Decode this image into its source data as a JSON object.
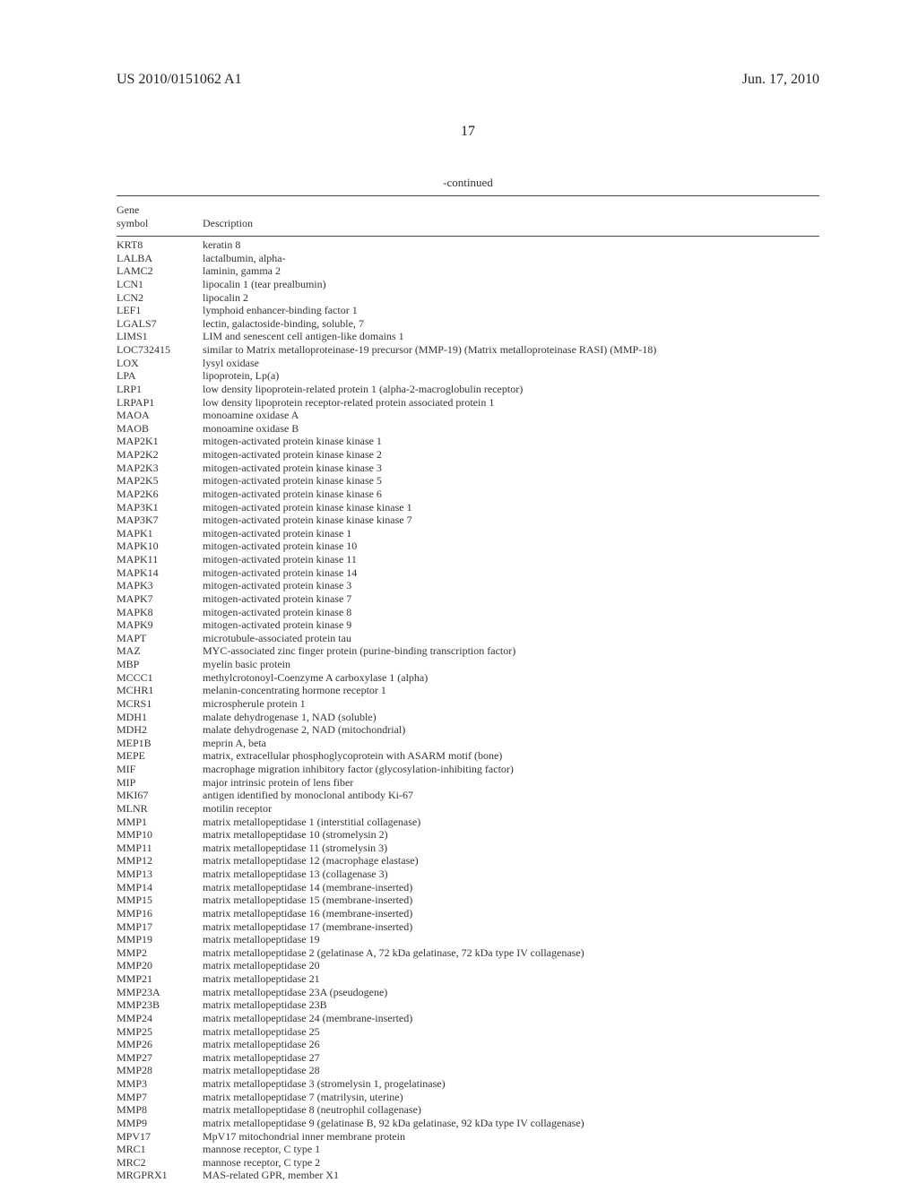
{
  "header": {
    "left": "US 2010/0151062 A1",
    "right": "Jun. 17, 2010",
    "page_number": "17"
  },
  "table": {
    "continued": "-continued",
    "col1": "Gene\nsymbol",
    "col2": "Description",
    "rows": [
      {
        "sym": "KRT8",
        "desc": "keratin 8"
      },
      {
        "sym": "LALBA",
        "desc": "lactalbumin, alpha-"
      },
      {
        "sym": "LAMC2",
        "desc": "laminin, gamma 2"
      },
      {
        "sym": "LCN1",
        "desc": "lipocalin 1 (tear prealbumin)"
      },
      {
        "sym": "LCN2",
        "desc": "lipocalin 2"
      },
      {
        "sym": "LEF1",
        "desc": "lymphoid enhancer-binding factor 1"
      },
      {
        "sym": "LGALS7",
        "desc": "lectin, galactoside-binding, soluble, 7"
      },
      {
        "sym": "LIMS1",
        "desc": "LIM and senescent cell antigen-like domains 1"
      },
      {
        "sym": "LOC732415",
        "desc": "similar to Matrix metalloproteinase-19 precursor (MMP-19) (Matrix metalloproteinase RASI) (MMP-18)"
      },
      {
        "sym": "LOX",
        "desc": "lysyl oxidase"
      },
      {
        "sym": "LPA",
        "desc": "lipoprotein, Lp(a)"
      },
      {
        "sym": "LRP1",
        "desc": "low density lipoprotein-related protein 1 (alpha-2-macroglobulin receptor)"
      },
      {
        "sym": "LRPAP1",
        "desc": "low density lipoprotein receptor-related protein associated protein 1"
      },
      {
        "sym": "MAOA",
        "desc": "monoamine oxidase A"
      },
      {
        "sym": "MAOB",
        "desc": "monoamine oxidase B"
      },
      {
        "sym": "MAP2K1",
        "desc": "mitogen-activated protein kinase kinase 1"
      },
      {
        "sym": "MAP2K2",
        "desc": "mitogen-activated protein kinase kinase 2"
      },
      {
        "sym": "MAP2K3",
        "desc": "mitogen-activated protein kinase kinase 3"
      },
      {
        "sym": "MAP2K5",
        "desc": "mitogen-activated protein kinase kinase 5"
      },
      {
        "sym": "MAP2K6",
        "desc": "mitogen-activated protein kinase kinase 6"
      },
      {
        "sym": "MAP3K1",
        "desc": "mitogen-activated protein kinase kinase kinase 1"
      },
      {
        "sym": "MAP3K7",
        "desc": "mitogen-activated protein kinase kinase kinase 7"
      },
      {
        "sym": "MAPK1",
        "desc": "mitogen-activated protein kinase 1"
      },
      {
        "sym": "MAPK10",
        "desc": "mitogen-activated protein kinase 10"
      },
      {
        "sym": "MAPK11",
        "desc": "mitogen-activated protein kinase 11"
      },
      {
        "sym": "MAPK14",
        "desc": "mitogen-activated protein kinase 14"
      },
      {
        "sym": "MAPK3",
        "desc": "mitogen-activated protein kinase 3"
      },
      {
        "sym": "MAPK7",
        "desc": "mitogen-activated protein kinase 7"
      },
      {
        "sym": "MAPK8",
        "desc": "mitogen-activated protein kinase 8"
      },
      {
        "sym": "MAPK9",
        "desc": "mitogen-activated protein kinase 9"
      },
      {
        "sym": "MAPT",
        "desc": "microtubule-associated protein tau"
      },
      {
        "sym": "MAZ",
        "desc": "MYC-associated zinc finger protein (purine-binding transcription factor)"
      },
      {
        "sym": "MBP",
        "desc": "myelin basic protein"
      },
      {
        "sym": "MCCC1",
        "desc": "methylcrotonoyl-Coenzyme A carboxylase 1 (alpha)"
      },
      {
        "sym": "MCHR1",
        "desc": "melanin-concentrating hormone receptor 1"
      },
      {
        "sym": "MCRS1",
        "desc": "microspherule protein 1"
      },
      {
        "sym": "MDH1",
        "desc": "malate dehydrogenase 1, NAD (soluble)"
      },
      {
        "sym": "MDH2",
        "desc": "malate dehydrogenase 2, NAD (mitochondrial)"
      },
      {
        "sym": "MEP1B",
        "desc": "meprin A, beta"
      },
      {
        "sym": "MEPE",
        "desc": "matrix, extracellular phosphoglycoprotein with ASARM motif (bone)"
      },
      {
        "sym": "MIF",
        "desc": "macrophage migration inhibitory factor (glycosylation-inhibiting factor)"
      },
      {
        "sym": "MIP",
        "desc": "major intrinsic protein of lens fiber"
      },
      {
        "sym": "MKI67",
        "desc": "antigen identified by monoclonal antibody Ki-67"
      },
      {
        "sym": "MLNR",
        "desc": "motilin receptor"
      },
      {
        "sym": "MMP1",
        "desc": "matrix metallopeptidase 1 (interstitial collagenase)"
      },
      {
        "sym": "MMP10",
        "desc": "matrix metallopeptidase 10 (stromelysin 2)"
      },
      {
        "sym": "MMP11",
        "desc": "matrix metallopeptidase 11 (stromelysin 3)"
      },
      {
        "sym": "MMP12",
        "desc": "matrix metallopeptidase 12 (macrophage elastase)"
      },
      {
        "sym": "MMP13",
        "desc": "matrix metallopeptidase 13 (collagenase 3)"
      },
      {
        "sym": "MMP14",
        "desc": "matrix metallopeptidase 14 (membrane-inserted)"
      },
      {
        "sym": "MMP15",
        "desc": "matrix metallopeptidase 15 (membrane-inserted)"
      },
      {
        "sym": "MMP16",
        "desc": "matrix metallopeptidase 16 (membrane-inserted)"
      },
      {
        "sym": "MMP17",
        "desc": "matrix metallopeptidase 17 (membrane-inserted)"
      },
      {
        "sym": "MMP19",
        "desc": "matrix metallopeptidase 19"
      },
      {
        "sym": "MMP2",
        "desc": "matrix metallopeptidase 2 (gelatinase A, 72 kDa gelatinase, 72 kDa type IV collagenase)"
      },
      {
        "sym": "MMP20",
        "desc": "matrix metallopeptidase 20"
      },
      {
        "sym": "MMP21",
        "desc": "matrix metallopeptidase 21"
      },
      {
        "sym": "MMP23A",
        "desc": "matrix metallopeptidase 23A (pseudogene)"
      },
      {
        "sym": "MMP23B",
        "desc": "matrix metallopeptidase 23B"
      },
      {
        "sym": "MMP24",
        "desc": "matrix metallopeptidase 24 (membrane-inserted)"
      },
      {
        "sym": "MMP25",
        "desc": "matrix metallopeptidase 25"
      },
      {
        "sym": "MMP26",
        "desc": "matrix metallopeptidase 26"
      },
      {
        "sym": "MMP27",
        "desc": "matrix metallopeptidase 27"
      },
      {
        "sym": "MMP28",
        "desc": "matrix metallopeptidase 28"
      },
      {
        "sym": "MMP3",
        "desc": "matrix metallopeptidase 3 (stromelysin 1, progelatinase)"
      },
      {
        "sym": "MMP7",
        "desc": "matrix metallopeptidase 7 (matrilysin, uterine)"
      },
      {
        "sym": "MMP8",
        "desc": "matrix metallopeptidase 8 (neutrophil collagenase)"
      },
      {
        "sym": "MMP9",
        "desc": "matrix metallopeptidase 9 (gelatinase B, 92 kDa gelatinase, 92 kDa type IV collagenase)"
      },
      {
        "sym": "MPV17",
        "desc": "MpV17 mitochondrial inner membrane protein"
      },
      {
        "sym": "MRC1",
        "desc": "mannose receptor, C type 1"
      },
      {
        "sym": "MRC2",
        "desc": "mannose receptor, C type 2"
      },
      {
        "sym": "MRGPRX1",
        "desc": "MAS-related GPR, member X1"
      }
    ]
  }
}
